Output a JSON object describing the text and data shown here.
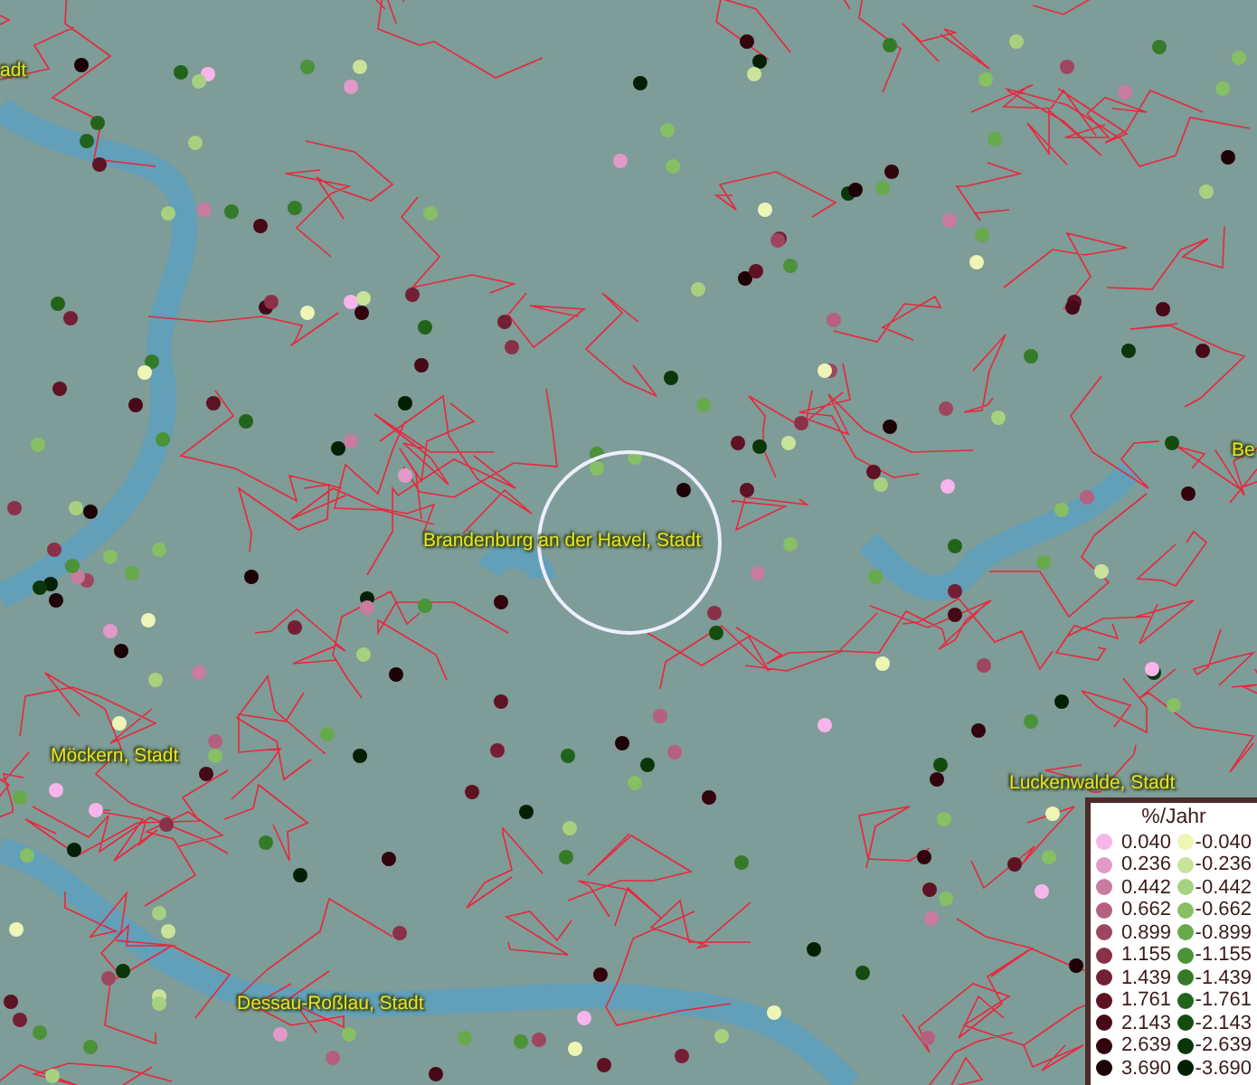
{
  "map": {
    "place_labels": [
      {
        "text": "adt"
      },
      {
        "text": "Brandenburg an der Havel, Stadt"
      },
      {
        "text": "Möckern, Stadt"
      },
      {
        "text": "Luckenwalde, Stadt"
      },
      {
        "text": "Dessau-Roßlau, Stadt"
      },
      {
        "text": "Be"
      }
    ]
  },
  "legend": {
    "title": "%/Jahr",
    "classes": [
      {
        "positive": {
          "label": "0.040",
          "color": "#f7b5ec"
        },
        "negative": {
          "label": "-0.040",
          "color": "#eef5b5"
        }
      },
      {
        "positive": {
          "label": "0.236",
          "color": "#e19ac8"
        },
        "negative": {
          "label": "-0.236",
          "color": "#c9e39a"
        }
      },
      {
        "positive": {
          "label": "0.442",
          "color": "#c97ba0"
        },
        "negative": {
          "label": "-0.442",
          "color": "#a6d17f"
        }
      },
      {
        "positive": {
          "label": "0.662",
          "color": "#b5607f"
        },
        "negative": {
          "label": "-0.662",
          "color": "#86bf64"
        }
      },
      {
        "positive": {
          "label": "0.899",
          "color": "#9e4660"
        },
        "negative": {
          "label": "-0.899",
          "color": "#66aa4c"
        }
      },
      {
        "positive": {
          "label": "1.155",
          "color": "#8a3149"
        },
        "negative": {
          "label": "-1.155",
          "color": "#4b9238"
        }
      },
      {
        "positive": {
          "label": "1.439",
          "color": "#741f35"
        },
        "negative": {
          "label": "-1.439",
          "color": "#357a28"
        }
      },
      {
        "positive": {
          "label": "1.761",
          "color": "#5e1224"
        },
        "negative": {
          "label": "-1.761",
          "color": "#22631b"
        }
      },
      {
        "positive": {
          "label": "2.143",
          "color": "#470918"
        },
        "negative": {
          "label": "-2.143",
          "color": "#144c10"
        }
      },
      {
        "positive": {
          "label": "2.639",
          "color": "#32040e"
        },
        "negative": {
          "label": "-2.639",
          "color": "#0a3609"
        }
      },
      {
        "positive": {
          "label": "3.690",
          "color": "#1c0106"
        },
        "negative": {
          "label": "-3.690",
          "color": "#032004"
        }
      }
    ]
  }
}
